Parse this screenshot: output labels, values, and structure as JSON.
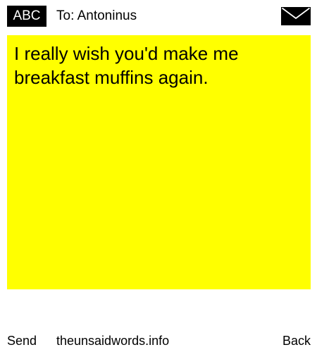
{
  "header": {
    "input_mode": "ABC",
    "recipient": "To: Antoninus"
  },
  "icons": {
    "envelope": "envelope-icon"
  },
  "message": {
    "text": "I really wish you'd make me breakfast muffins again.",
    "background_color": "#ffff00"
  },
  "footer": {
    "send_label": "Send",
    "site_label": "theunsaidwords.info",
    "back_label": "Back"
  }
}
